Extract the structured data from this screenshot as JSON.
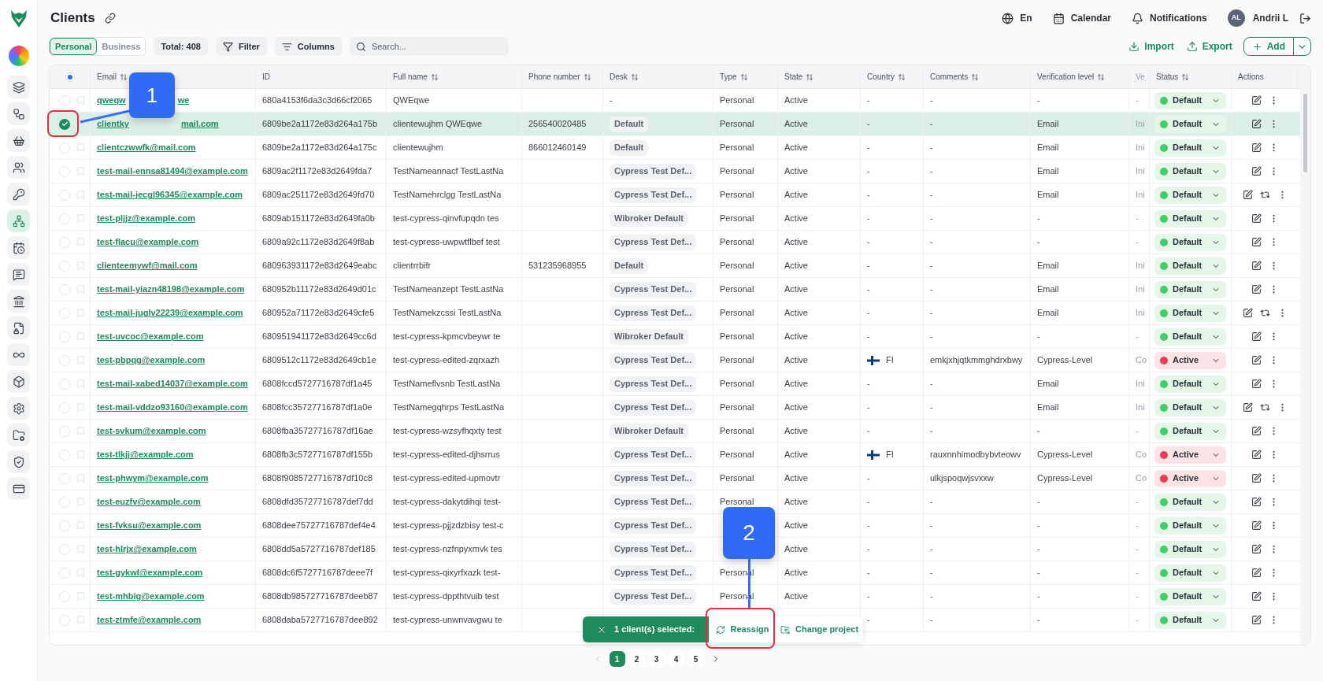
{
  "sidebar": {
    "items": [
      {
        "selected": false
      },
      {
        "selected": false
      },
      {
        "selected": false
      },
      {
        "selected": false
      },
      {
        "selected": false
      },
      {
        "selected": true
      },
      {
        "selected": false
      },
      {
        "selected": false
      },
      {
        "selected": false
      },
      {
        "selected": false
      },
      {
        "selected": false
      },
      {
        "selected": false
      },
      {
        "selected": false
      },
      {
        "selected": false
      },
      {
        "selected": false
      },
      {
        "selected": false
      }
    ]
  },
  "header": {
    "title": "Clients",
    "language": "En",
    "calendar": "Calendar",
    "notifications": "Notifications",
    "avatar": "AL",
    "user": "Andrii L"
  },
  "toolbar": {
    "segments": [
      {
        "label": "Personal",
        "selected": true
      },
      {
        "label": "Business",
        "selected": false
      }
    ],
    "total": "Total: 408",
    "filter": "Filter",
    "columns": "Columns",
    "search": {
      "placeholder": "Search..."
    },
    "import": "Import",
    "export": "Export",
    "add": "Add"
  },
  "table": {
    "header_checkbox": {
      "partial": true
    },
    "columns": [
      {
        "label": "Email",
        "sortable": true,
        "dimmed": false
      },
      {
        "label": "ID",
        "sortable": false,
        "dimmed": false
      },
      {
        "label": "Full name",
        "sortable": true,
        "dimmed": false
      },
      {
        "label": "Phone number",
        "sortable": true,
        "dimmed": false
      },
      {
        "label": "Desk",
        "sortable": true,
        "dimmed": false
      },
      {
        "label": "Type",
        "sortable": true,
        "dimmed": false
      },
      {
        "label": "State",
        "sortable": true,
        "dimmed": false
      },
      {
        "label": "Country",
        "sortable": true,
        "dimmed": false
      },
      {
        "label": "Comments",
        "sortable": true,
        "dimmed": false
      },
      {
        "label": "Verification level",
        "sortable": true,
        "dimmed": false
      },
      {
        "label": "Ve",
        "sortable": false,
        "dimmed": true
      },
      {
        "label": "Status",
        "sortable": true,
        "dimmed": false
      },
      {
        "label": "Actions",
        "sortable": false,
        "dimmed": false
      }
    ],
    "rows": [
      {
        "selected": false,
        "email": "qweqw",
        "email_tail": "we",
        "id": "680a4153f6da3c3d66cf2065",
        "full_name": "QWEqwe",
        "desk": "-",
        "desk_tag": false,
        "type": "Personal",
        "state": "Active",
        "country": "-",
        "country_flag": false,
        "comments": "-",
        "verification": "-",
        "ve": "-",
        "status": {
          "label": "Default",
          "kind": "default",
          "color": "#3ecf6a"
        },
        "extra_action": false
      },
      {
        "selected": true,
        "email": "clientky",
        "email_tail": "mail.com",
        "id": "6809be2a1172e83d264a175b",
        "full_name": "clientewujhm QWEqwe",
        "phone": "256540020485",
        "desk": "Default",
        "desk_tag": true,
        "type": "Personal",
        "state": "Active",
        "country": "-",
        "country_flag": false,
        "comments": "-",
        "verification": "Email",
        "ve": "Ini",
        "status": {
          "label": "Default",
          "kind": "default",
          "color": "#3ecf6a"
        },
        "extra_action": false
      },
      {
        "selected": false,
        "email": "clientczwwfk@mail.com",
        "id": "6809be2a1172e83d264a175c",
        "full_name": "clientewujhm",
        "phone": "866012460149",
        "desk": "Default",
        "desk_tag": true,
        "type": "Personal",
        "state": "Active",
        "country": "-",
        "country_flag": false,
        "comments": "-",
        "verification": "Email",
        "ve": "Ini",
        "status": {
          "label": "Default",
          "kind": "default",
          "color": "#3ecf6a"
        },
        "extra_action": false
      },
      {
        "selected": false,
        "email": "test-mail-ennsa81494@example.com",
        "id": "6809ac2f1172e83d2649fda7",
        "full_name": "TestNameannacf TestLastNa",
        "desk": "Cypress Test Def...",
        "desk_tag": true,
        "type": "Personal",
        "state": "Active",
        "country": "-",
        "country_flag": false,
        "comments": "-",
        "verification": "Email",
        "ve": "Ini",
        "status": {
          "label": "Default",
          "kind": "default",
          "color": "#3ecf6a"
        },
        "extra_action": false
      },
      {
        "selected": false,
        "email": "test-mail-jecgl96345@example.com",
        "id": "6809ac251172e83d2649fd70",
        "full_name": "TestNamehrclgg TestLastNa",
        "desk": "Cypress Test Def...",
        "desk_tag": true,
        "type": "Personal",
        "state": "Active",
        "country": "-",
        "country_flag": false,
        "comments": "-",
        "verification": "Email",
        "ve": "Ini",
        "status": {
          "label": "Default",
          "kind": "default",
          "color": "#3ecf6a"
        },
        "extra_action": true
      },
      {
        "selected": false,
        "email": "test-pljjz@example.com",
        "id": "6809ab151172e83d2649fa0b",
        "full_name": "test-cypress-qinvfupqdn tes",
        "desk": "Wibroker Default",
        "desk_tag": true,
        "type": "Personal",
        "state": "Active",
        "country": "-",
        "country_flag": false,
        "comments": "-",
        "verification": "-",
        "ve": "-",
        "status": {
          "label": "Default",
          "kind": "default",
          "color": "#3ecf6a"
        },
        "extra_action": false
      },
      {
        "selected": false,
        "email": "test-flacu@example.com",
        "id": "6809a92c1172e83d2649f8ab",
        "full_name": "test-cypress-uwpwtflbef test",
        "desk": "Cypress Test Def...",
        "desk_tag": true,
        "type": "Personal",
        "state": "Active",
        "country": "-",
        "country_flag": false,
        "comments": "-",
        "verification": "-",
        "ve": "-",
        "status": {
          "label": "Default",
          "kind": "default",
          "color": "#3ecf6a"
        },
        "extra_action": false
      },
      {
        "selected": false,
        "email": "clienteemywf@mail.com",
        "id": "680963931172e83d2649eabc",
        "full_name": "clientrrbifr",
        "phone": "531235968955",
        "desk": "Default",
        "desk_tag": true,
        "type": "Personal",
        "state": "Active",
        "country": "-",
        "country_flag": false,
        "comments": "-",
        "verification": "Email",
        "ve": "Ini",
        "status": {
          "label": "Default",
          "kind": "default",
          "color": "#3ecf6a"
        },
        "extra_action": false
      },
      {
        "selected": false,
        "email": "test-mail-yiazn48198@example.com",
        "id": "680952b11172e83d2649d01c",
        "full_name": "TestNameanzept TestLastNa",
        "desk": "Cypress Test Def...",
        "desk_tag": true,
        "type": "Personal",
        "state": "Active",
        "country": "-",
        "country_flag": false,
        "comments": "-",
        "verification": "Email",
        "ve": "Ini",
        "status": {
          "label": "Default",
          "kind": "default",
          "color": "#3ecf6a"
        },
        "extra_action": false
      },
      {
        "selected": false,
        "email": "test-mail-juglv22239@example.com",
        "id": "680952a71172e83d2649cfe5",
        "full_name": "TestNamekzcssi TestLastNa",
        "desk": "Cypress Test Def...",
        "desk_tag": true,
        "type": "Personal",
        "state": "Active",
        "country": "-",
        "country_flag": false,
        "comments": "-",
        "verification": "Email",
        "ve": "Ini",
        "status": {
          "label": "Default",
          "kind": "default",
          "color": "#3ecf6a"
        },
        "extra_action": true
      },
      {
        "selected": false,
        "email": "test-uvcoc@example.com",
        "id": "680951941172e83d2649cc6d",
        "full_name": "test-cypress-kpmcvbeywr te",
        "desk": "Wibroker Default",
        "desk_tag": true,
        "type": "Personal",
        "state": "Active",
        "country": "-",
        "country_flag": false,
        "comments": "-",
        "verification": "-",
        "ve": "-",
        "status": {
          "label": "Default",
          "kind": "default",
          "color": "#3ecf6a"
        },
        "extra_action": false
      },
      {
        "selected": false,
        "email": "test-pbpqg@example.com",
        "id": "6809512c1172e83d2649cb1e",
        "full_name": "test-cypress-edited-zqrxazh",
        "desk": "Cypress Test Def...",
        "desk_tag": true,
        "type": "Personal",
        "state": "Active",
        "country": "FI",
        "country_flag": true,
        "comments": "emkjxhjqtkmmghdrxbwy",
        "verification": "Cypress-Level",
        "ve": "Co",
        "status": {
          "label": "Active",
          "kind": "alert",
          "color": "#ec3b56"
        },
        "extra_action": false
      },
      {
        "selected": false,
        "email": "test-mail-xabed14037@example.com",
        "id": "6808fccd5727716787df1a45",
        "full_name": "TestNameflvsnb TestLastNa",
        "desk": "Cypress Test Def...",
        "desk_tag": true,
        "type": "Personal",
        "state": "Active",
        "country": "-",
        "country_flag": false,
        "comments": "-",
        "verification": "Email",
        "ve": "Ini",
        "status": {
          "label": "Default",
          "kind": "default",
          "color": "#3ecf6a"
        },
        "extra_action": false
      },
      {
        "selected": false,
        "email": "test-mail-vddzo93160@example.com",
        "id": "6808fcc35727716787df1a0e",
        "full_name": "TestNamegqhrps TestLastNa",
        "desk": "Cypress Test Def...",
        "desk_tag": true,
        "type": "Personal",
        "state": "Active",
        "country": "-",
        "country_flag": false,
        "comments": "-",
        "verification": "Email",
        "ve": "Ini",
        "status": {
          "label": "Default",
          "kind": "default",
          "color": "#3ecf6a"
        },
        "extra_action": true
      },
      {
        "selected": false,
        "email": "test-svkum@example.com",
        "id": "6808fba35727716787df16ae",
        "full_name": "test-cypress-wzsyfhqxty test",
        "desk": "Wibroker Default",
        "desk_tag": true,
        "type": "Personal",
        "state": "Active",
        "country": "-",
        "country_flag": false,
        "comments": "-",
        "verification": "-",
        "ve": "-",
        "status": {
          "label": "Default",
          "kind": "default",
          "color": "#3ecf6a"
        },
        "extra_action": false
      },
      {
        "selected": false,
        "email": "test-tlkjj@example.com",
        "id": "6808fb3c5727716787df155b",
        "full_name": "test-cypress-edited-djhsrrus",
        "desk": "Cypress Test Def...",
        "desk_tag": true,
        "type": "Personal",
        "state": "Active",
        "country": "FI",
        "country_flag": true,
        "comments": "rauxnnhimodbybvteowv",
        "verification": "Cypress-Level",
        "ve": "Co",
        "status": {
          "label": "Active",
          "kind": "alert",
          "color": "#ec3b56"
        },
        "extra_action": false
      },
      {
        "selected": false,
        "email": "test-phwym@example.com",
        "id": "6808f9085727716787df10c8",
        "full_name": "test-cypress-edited-upmovtr",
        "desk": "Cypress Test Def...",
        "desk_tag": true,
        "type": "Personal",
        "state": "Active",
        "country": "-",
        "country_flag": false,
        "comments": "ulkjspoqwjsvxxw",
        "verification": "Cypress-Level",
        "ve": "Co",
        "status": {
          "label": "Active",
          "kind": "alert",
          "color": "#ec3b56"
        },
        "extra_action": false
      },
      {
        "selected": false,
        "email": "test-euzfv@example.com",
        "id": "6808dfd35727716787def7dd",
        "full_name": "test-cypress-dakytdihqi test-",
        "desk": "Cypress Test Def...",
        "desk_tag": true,
        "type": "Personal",
        "state": "Active",
        "country": "-",
        "country_flag": false,
        "comments": "-",
        "verification": "-",
        "ve": "-",
        "status": {
          "label": "Default",
          "kind": "default",
          "color": "#3ecf6a"
        },
        "extra_action": false
      },
      {
        "selected": false,
        "email": "test-fvksu@example.com",
        "id": "6808dee75727716787def4e4",
        "full_name": "test-cypress-pjjzdzbisy test-c",
        "desk": "Cypress Test Def...",
        "desk_tag": true,
        "state": "Active",
        "country": "-",
        "country_flag": false,
        "comments": "-",
        "verification": "-",
        "ve": "-",
        "status": {
          "label": "Default",
          "kind": "default",
          "color": "#3ecf6a"
        },
        "extra_action": false
      },
      {
        "selected": false,
        "email": "test-hlrjx@example.com",
        "id": "6808dd5a5727716787def185",
        "full_name": "test-cypress-nzfnpyxmvk tes",
        "desk": "Cypress Test Def...",
        "desk_tag": true,
        "state": "Active",
        "country": "-",
        "country_flag": false,
        "comments": "-",
        "verification": "-",
        "ve": "-",
        "status": {
          "label": "Default",
          "kind": "default",
          "color": "#3ecf6a"
        },
        "extra_action": false
      },
      {
        "selected": false,
        "email": "test-gykwl@example.com",
        "id": "6808dc6f5727716787deee7f",
        "full_name": "test-cypress-qixyrfxazk test-",
        "desk": "Cypress Test Def...",
        "desk_tag": true,
        "type": "Personal",
        "state": "Active",
        "country": "-",
        "country_flag": false,
        "comments": "-",
        "verification": "-",
        "ve": "-",
        "status": {
          "label": "Default",
          "kind": "default",
          "color": "#3ecf6a"
        },
        "extra_action": false
      },
      {
        "selected": false,
        "email": "test-mhbig@example.com",
        "id": "6808db985727716787deeb87",
        "full_name": "test-cypress-dppthtvuib test",
        "desk": "Cypress Test Def...",
        "desk_tag": true,
        "type": "Personal",
        "state": "Active",
        "country": "-",
        "country_flag": false,
        "comments": "-",
        "verification": "-",
        "ve": "-",
        "status": {
          "label": "Default",
          "kind": "default",
          "color": "#3ecf6a"
        },
        "extra_action": false
      },
      {
        "selected": false,
        "email": "test-ztmfe@example.com",
        "id": "6808daba5727716787dee892",
        "full_name": "test-cypress-unwnvavgwu te",
        "country": "-",
        "country_flag": false,
        "comments": "-",
        "verification": "-",
        "ve": "-",
        "status": {
          "label": "Default",
          "kind": "default",
          "color": "#3ecf6a"
        },
        "extra_action": false
      }
    ]
  },
  "bulk_bar": {
    "summary": "1 client(s) selected:",
    "actions": [
      "Reassign",
      "Change project"
    ]
  },
  "pagination": {
    "pages": [
      {
        "label": "1",
        "selected": true
      },
      {
        "label": "2",
        "selected": false
      },
      {
        "label": "3",
        "selected": false
      },
      {
        "label": "4",
        "selected": false
      },
      {
        "label": "5",
        "selected": false
      }
    ]
  },
  "annotations": [
    {
      "label": "1"
    },
    {
      "label": "2"
    }
  ]
}
